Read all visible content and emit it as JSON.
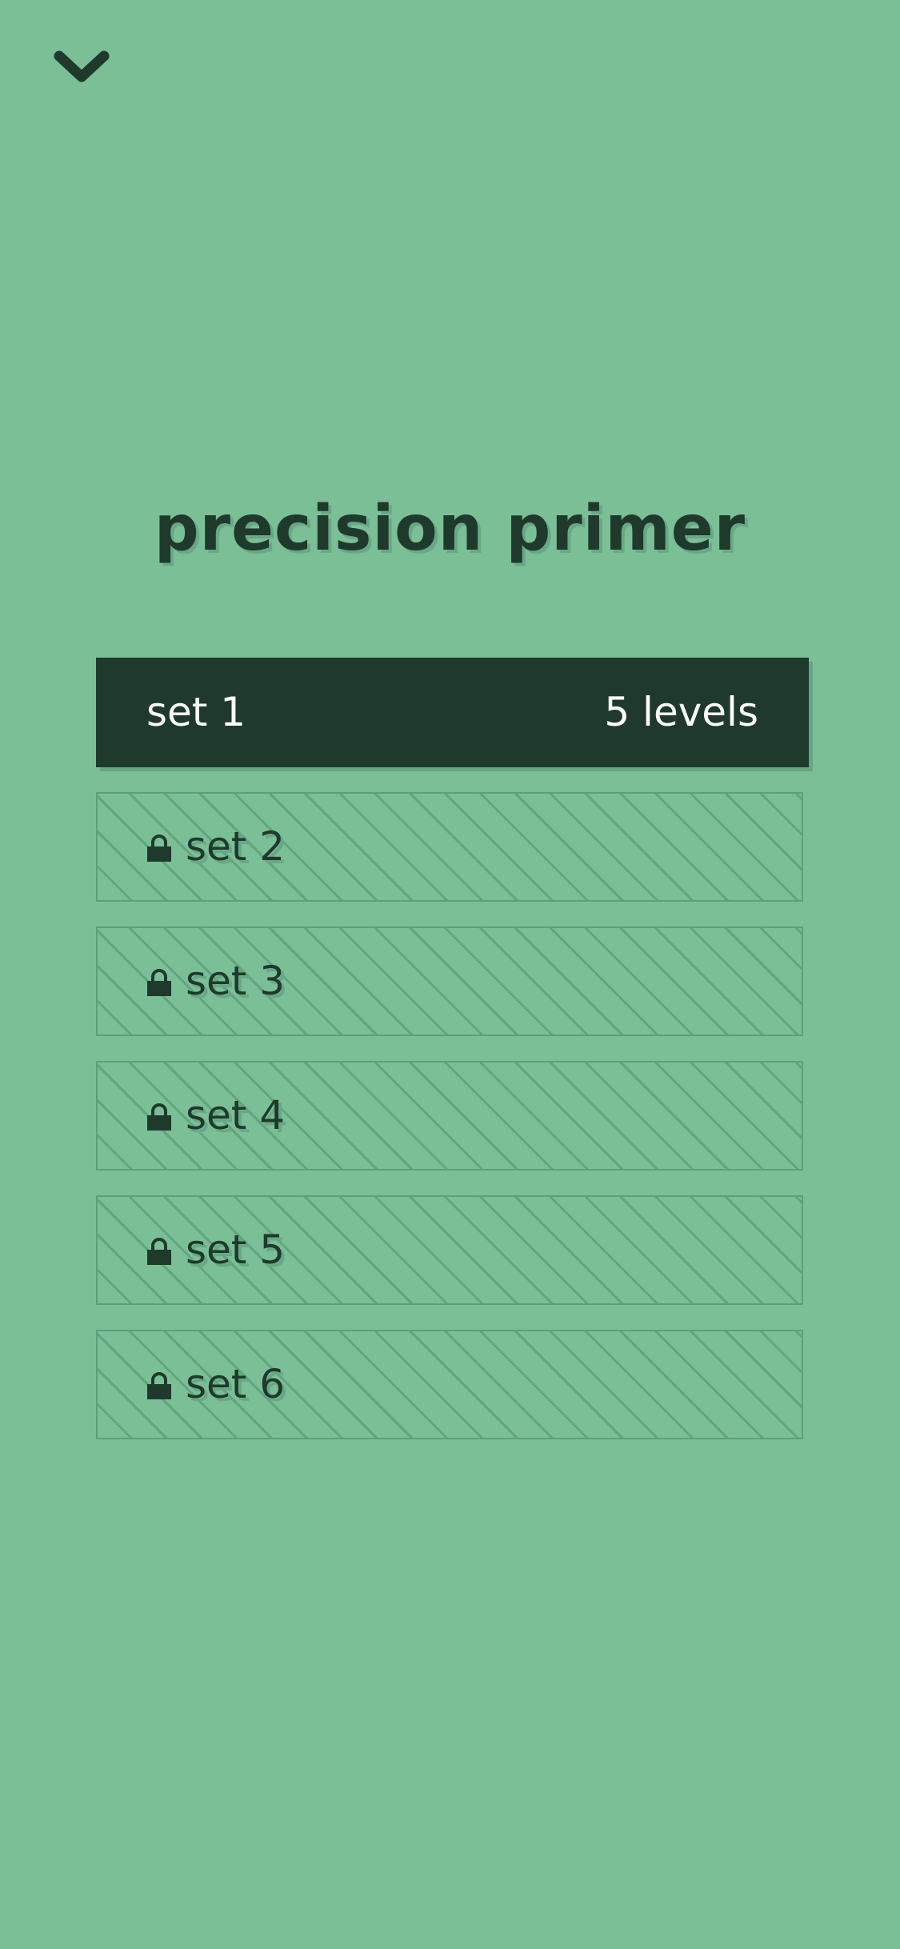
{
  "nav": {
    "collapse_icon": "chevron-down-icon"
  },
  "title": "precision primer",
  "sets": [
    {
      "label": "set 1",
      "levels": "5 levels",
      "locked": false
    },
    {
      "label": "set 2",
      "locked": true,
      "icon": "lock-icon"
    },
    {
      "label": "set 3",
      "locked": true,
      "icon": "lock-icon"
    },
    {
      "label": "set 4",
      "locked": true,
      "icon": "lock-icon"
    },
    {
      "label": "set 5",
      "locked": true,
      "icon": "lock-icon"
    },
    {
      "label": "set 6",
      "locked": true,
      "icon": "lock-icon"
    }
  ],
  "colors": {
    "background": "#7bbf97",
    "dark": "#1f3a2c",
    "stripe": "#61a47e",
    "shadow": "#69a886"
  }
}
